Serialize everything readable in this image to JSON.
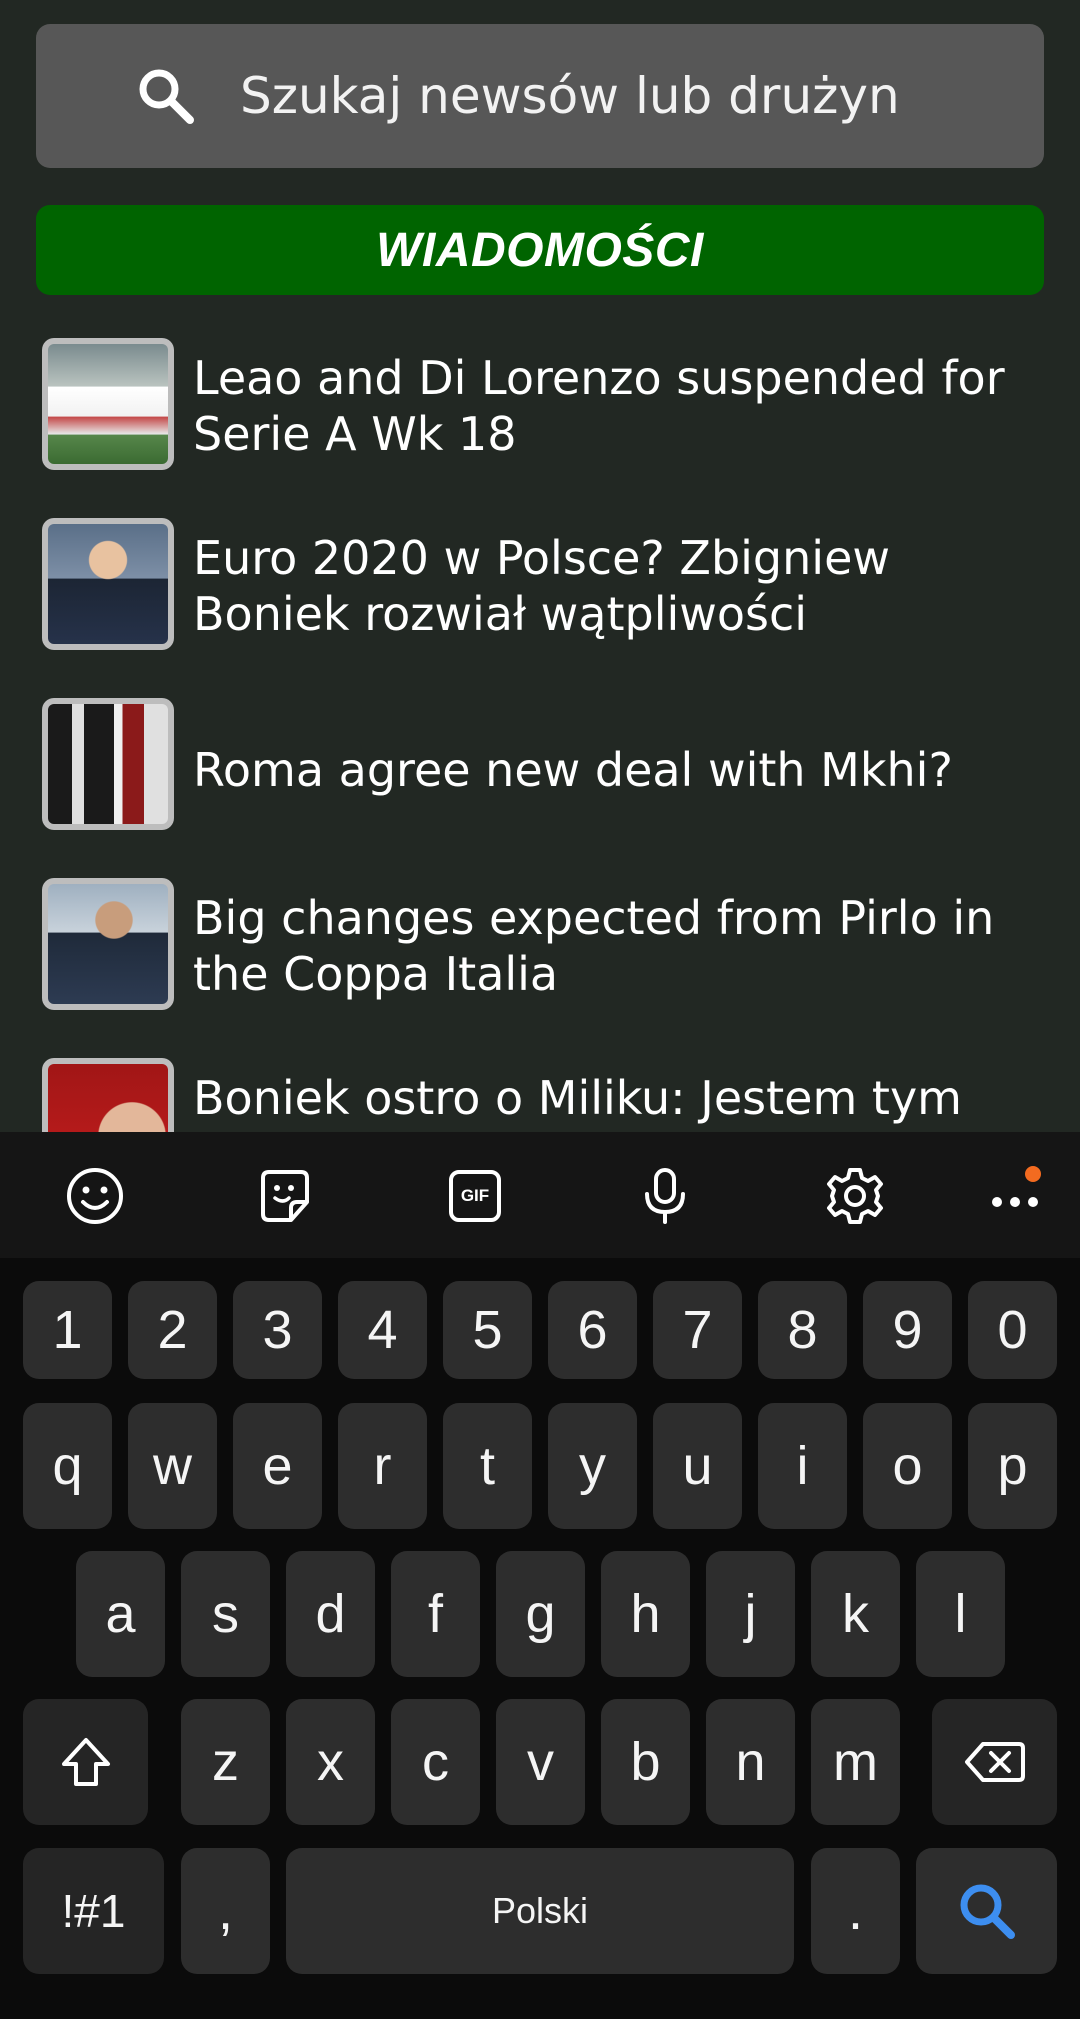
{
  "search": {
    "placeholder": "Szukaj newsów lub drużyn"
  },
  "section": {
    "title": "WIADOMOŚCI"
  },
  "news": [
    {
      "title": "Leao and Di Lorenzo suspended for Serie A Wk 18"
    },
    {
      "title": "Euro 2020 w Polsce? Zbigniew Boniek rozwiał wątpliwości"
    },
    {
      "title": "Roma agree new deal with Mkhi?"
    },
    {
      "title": "Big changes expected from Pirlo in the Coppa Italia"
    },
    {
      "title": "Boniek ostro o Miliku: Jestem tym"
    }
  ],
  "toolbar": {
    "icons": [
      "emoji-icon",
      "sticker-icon",
      "gif-icon",
      "microphone-icon",
      "settings-icon",
      "more-icon"
    ],
    "gif_label": "GIF",
    "notification_color": "#f36b20"
  },
  "keyboard": {
    "row_numbers": [
      "1",
      "2",
      "3",
      "4",
      "5",
      "6",
      "7",
      "8",
      "9",
      "0"
    ],
    "row1": [
      "q",
      "w",
      "e",
      "r",
      "t",
      "y",
      "u",
      "i",
      "o",
      "p"
    ],
    "row2": [
      "a",
      "s",
      "d",
      "f",
      "g",
      "h",
      "j",
      "k",
      "l"
    ],
    "row3": [
      "z",
      "x",
      "c",
      "v",
      "b",
      "n",
      "m"
    ],
    "symbols_label": "!#1",
    "comma_label": ",",
    "space_label": "Polski",
    "period_label": ".",
    "accent_color": "#3d8ef0"
  },
  "colors": {
    "background": "#222823",
    "section_header": "#006400",
    "search_bar": "#575757"
  }
}
